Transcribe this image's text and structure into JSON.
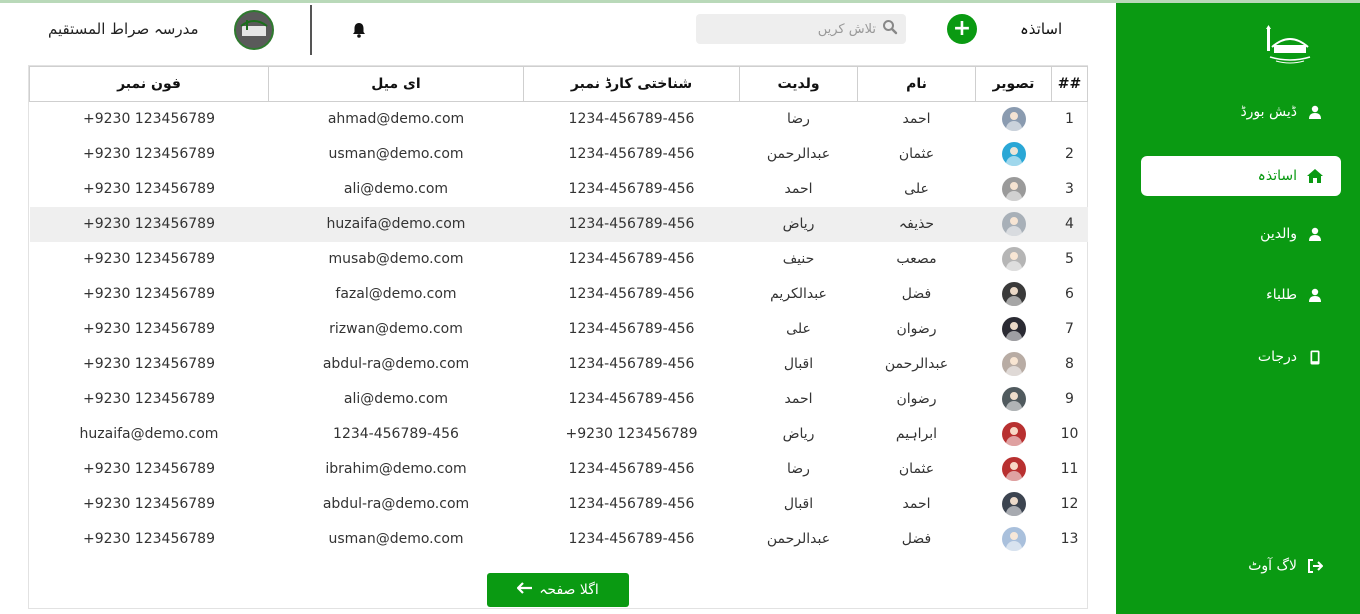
{
  "header": {
    "school_name": "مدرسہ صراط المستقیم",
    "page_title": "اساتذہ",
    "search_placeholder": "تلاش کریں"
  },
  "sidebar": {
    "items": [
      {
        "label": "ڈیش بورڈ",
        "icon": "user-icon"
      },
      {
        "label": "اساتذہ",
        "icon": "home-icon",
        "active": true
      },
      {
        "label": "والدین",
        "icon": "user-icon"
      },
      {
        "label": "طلباء",
        "icon": "user-icon"
      },
      {
        "label": "درجات",
        "icon": "mobile-icon"
      }
    ],
    "logout_label": "لاگ آوٹ"
  },
  "table": {
    "headers": [
      "##",
      "تصویر",
      "نام",
      "ولدیت",
      "شناختی کارڈ نمبر",
      "ای میل",
      "فون نمبر"
    ],
    "rows": [
      {
        "no": "1",
        "name": "احمد",
        "father": "رضا",
        "cnic": "1234-456789-456",
        "email": "ahmad@demo.com",
        "phone": "+9230 123456789",
        "avatar_color": "#8a9bb0"
      },
      {
        "no": "2",
        "name": "عثمان",
        "father": "عبدالرحمن",
        "cnic": "1234-456789-456",
        "email": "usman@demo.com",
        "phone": "+9230 123456789",
        "avatar_color": "#2aa7d6"
      },
      {
        "no": "3",
        "name": "علی",
        "father": "احمد",
        "cnic": "1234-456789-456",
        "email": "ali@demo.com",
        "phone": "+9230 123456789",
        "avatar_color": "#9a9a9a"
      },
      {
        "no": "4",
        "name": "حذیفہ",
        "father": "ریاض",
        "cnic": "1234-456789-456",
        "email": "huzaifa@demo.com",
        "phone": "+9230 123456789",
        "avatar_color": "#a8b0b8"
      },
      {
        "no": "5",
        "name": "مصعب",
        "father": "حنیف",
        "cnic": "1234-456789-456",
        "email": "musab@demo.com",
        "phone": "+9230 123456789",
        "avatar_color": "#b5b5b5"
      },
      {
        "no": "6",
        "name": "فضل",
        "father": "عبدالکریم",
        "cnic": "1234-456789-456",
        "email": "fazal@demo.com",
        "phone": "+9230 123456789",
        "avatar_color": "#3a3a3a"
      },
      {
        "no": "7",
        "name": "رضوان",
        "father": "علی",
        "cnic": "1234-456789-456",
        "email": "rizwan@demo.com",
        "phone": "+9230 123456789",
        "avatar_color": "#2b2b33"
      },
      {
        "no": "8",
        "name": "عبدالرحمن",
        "father": "اقبال",
        "cnic": "1234-456789-456",
        "email": "abdul-ra@demo.com",
        "phone": "+9230 123456789",
        "avatar_color": "#b8aca4"
      },
      {
        "no": "9",
        "name": "رضوان",
        "father": "احمد",
        "cnic": "1234-456789-456",
        "email": "ali@demo.com",
        "phone": "+9230 123456789",
        "avatar_color": "#505a5e"
      },
      {
        "no": "10",
        "name": "ابراہیم",
        "father": "ریاض",
        "cnic": "+9230 123456789",
        "email": "1234-456789-456",
        "phone": "huzaifa@demo.com",
        "avatar_color": "#b83030"
      },
      {
        "no": "11",
        "name": "عثمان",
        "father": "رضا",
        "cnic": "1234-456789-456",
        "email": "ibrahim@demo.com",
        "phone": "+9230 123456789",
        "avatar_color": "#b83030"
      },
      {
        "no": "12",
        "name": "احمد",
        "father": "اقبال",
        "cnic": "1234-456789-456",
        "email": "abdul-ra@demo.com",
        "phone": "+9230 123456789",
        "avatar_color": "#3c4450"
      },
      {
        "no": "13",
        "name": "فضل",
        "father": "عبدالرحمن",
        "cnic": "1234-456789-456",
        "email": "usman@demo.com",
        "phone": "+9230 123456789",
        "avatar_color": "#a9c0dc"
      }
    ]
  },
  "pagination": {
    "next_label": "اگلا صفحہ"
  },
  "colors": {
    "brand_green": "#0a9a12",
    "row_highlight": "#efefef"
  }
}
